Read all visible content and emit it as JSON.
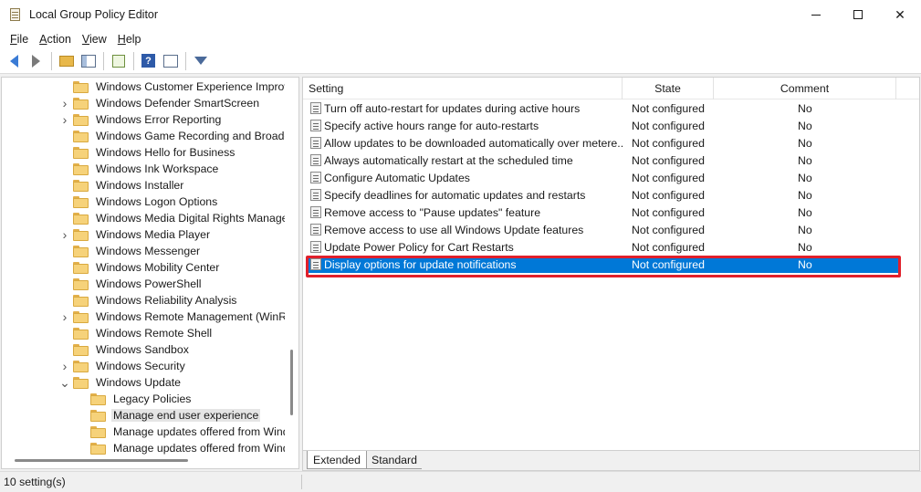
{
  "window": {
    "title": "Local Group Policy Editor",
    "controls": {
      "minimize": "",
      "maximize": "",
      "close": "✕"
    }
  },
  "menu": [
    {
      "key": "F",
      "rest": "ile"
    },
    {
      "key": "A",
      "rest": "ction"
    },
    {
      "key": "V",
      "rest": "iew"
    },
    {
      "key": "H",
      "rest": "elp"
    }
  ],
  "toolbar": {
    "icons": [
      "back-arrow-icon",
      "forward-arrow-icon",
      "up-folder-icon",
      "show-hide-tree-icon",
      "export-list-icon",
      "help-icon",
      "properties-icon",
      "filter-icon"
    ]
  },
  "tree": {
    "items": [
      {
        "label": "Windows Customer Experience Improv",
        "expander": "",
        "indent": 0
      },
      {
        "label": "Windows Defender SmartScreen",
        "expander": ">",
        "indent": 0
      },
      {
        "label": "Windows Error Reporting",
        "expander": ">",
        "indent": 0
      },
      {
        "label": "Windows Game Recording and Broadca",
        "expander": "",
        "indent": 0
      },
      {
        "label": "Windows Hello for Business",
        "expander": "",
        "indent": 0
      },
      {
        "label": "Windows Ink Workspace",
        "expander": "",
        "indent": 0
      },
      {
        "label": "Windows Installer",
        "expander": "",
        "indent": 0
      },
      {
        "label": "Windows Logon Options",
        "expander": "",
        "indent": 0
      },
      {
        "label": "Windows Media Digital Rights Manage",
        "expander": "",
        "indent": 0
      },
      {
        "label": "Windows Media Player",
        "expander": ">",
        "indent": 0
      },
      {
        "label": "Windows Messenger",
        "expander": "",
        "indent": 0
      },
      {
        "label": "Windows Mobility Center",
        "expander": "",
        "indent": 0
      },
      {
        "label": "Windows PowerShell",
        "expander": "",
        "indent": 0
      },
      {
        "label": "Windows Reliability Analysis",
        "expander": "",
        "indent": 0
      },
      {
        "label": "Windows Remote Management (WinRI",
        "expander": ">",
        "indent": 0
      },
      {
        "label": "Windows Remote Shell",
        "expander": "",
        "indent": 0
      },
      {
        "label": "Windows Sandbox",
        "expander": "",
        "indent": 0
      },
      {
        "label": "Windows Security",
        "expander": ">",
        "indent": 0
      },
      {
        "label": "Windows Update",
        "expander": "v",
        "indent": 0
      },
      {
        "label": "Legacy Policies",
        "expander": "",
        "indent": 1
      },
      {
        "label": "Manage end user experience",
        "expander": "",
        "indent": 1,
        "selected": true
      },
      {
        "label": "Manage updates offered from Wind",
        "expander": "",
        "indent": 1
      },
      {
        "label": "Manage updates offered from Wind",
        "expander": "",
        "indent": 1
      }
    ]
  },
  "table": {
    "columns": {
      "setting": "Setting",
      "state": "State",
      "comment": "Comment"
    },
    "rows": [
      {
        "setting": "Turn off auto-restart for updates during active hours",
        "state": "Not configured",
        "comment": "No"
      },
      {
        "setting": "Specify active hours range for auto-restarts",
        "state": "Not configured",
        "comment": "No"
      },
      {
        "setting": "Allow updates to be downloaded automatically over metere...",
        "state": "Not configured",
        "comment": "No"
      },
      {
        "setting": "Always automatically restart at the scheduled time",
        "state": "Not configured",
        "comment": "No"
      },
      {
        "setting": "Configure Automatic Updates",
        "state": "Not configured",
        "comment": "No"
      },
      {
        "setting": "Specify deadlines for automatic updates and restarts",
        "state": "Not configured",
        "comment": "No"
      },
      {
        "setting": "Remove access to \"Pause updates\" feature",
        "state": "Not configured",
        "comment": "No"
      },
      {
        "setting": "Remove access to use all Windows Update features",
        "state": "Not configured",
        "comment": "No"
      },
      {
        "setting": "Update Power Policy for Cart Restarts",
        "state": "Not configured",
        "comment": "No"
      },
      {
        "setting": "Display options for update notifications",
        "state": "Not configured",
        "comment": "No",
        "selected": true
      }
    ]
  },
  "tabs": [
    {
      "label": "Extended"
    },
    {
      "label": "Standard"
    }
  ],
  "status": {
    "text": "10 setting(s)"
  },
  "colors": {
    "selection": "#0078d7",
    "highlight_outline": "#e0202b",
    "folder": "#f6d27a"
  }
}
